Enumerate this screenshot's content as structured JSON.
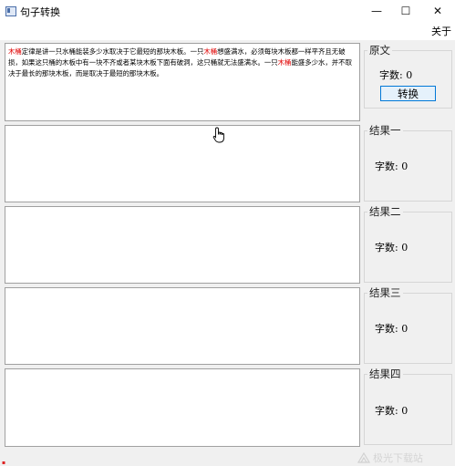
{
  "window": {
    "title": "句子转换",
    "about_menu": "关于",
    "minimize_glyph": "—",
    "maximize_glyph": "☐",
    "close_glyph": "✕"
  },
  "source": {
    "group_label": "原文",
    "count_label": "字数: 0",
    "convert_button": "转换",
    "segments": [
      {
        "t": "木桶",
        "hl": true
      },
      {
        "t": "定律是讲一只水桶能装多少水取决于它最短的那块木板。一只",
        "hl": false
      },
      {
        "t": "木桶",
        "hl": true
      },
      {
        "t": "想盛满水，必须每块木板都一样平齐且无破损，如果这只桶的木板中有一块不齐或者某块木板下面有破洞，这只桶就无法盛满水。一只",
        "hl": false
      },
      {
        "t": "木桶",
        "hl": true
      },
      {
        "t": "能盛多少水，并不取决于最长的那块木板，而是取决于最短的那块木板。",
        "hl": false
      }
    ]
  },
  "results": [
    {
      "label": "结果一",
      "count": "字数: 0"
    },
    {
      "label": "结果二",
      "count": "字数: 0"
    },
    {
      "label": "结果三",
      "count": "字数: 0"
    },
    {
      "label": "结果四",
      "count": "字数: 0"
    }
  ],
  "watermark": {
    "text": "极光下载站",
    "icon": "aurora-logo-icon"
  },
  "colors": {
    "highlight": "#e00000",
    "button_border": "#0078d7",
    "button_bg": "#e5f1fb"
  }
}
